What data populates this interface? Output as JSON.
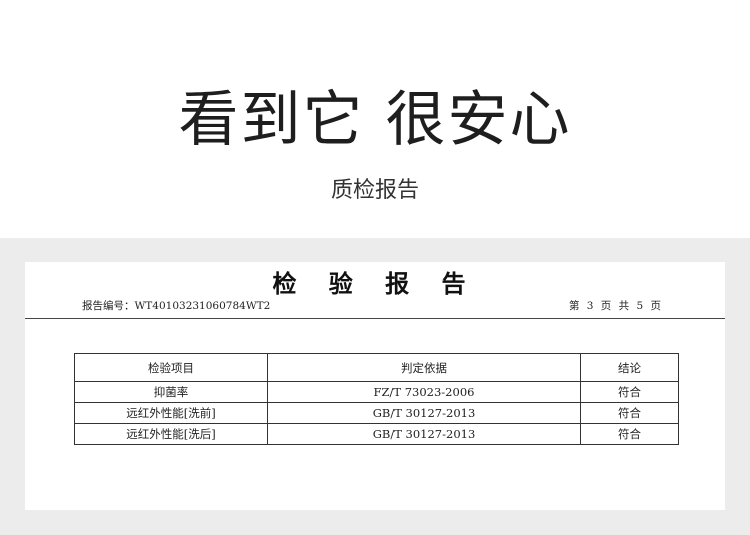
{
  "hero": {
    "title": "看到它 很安心",
    "subtitle": "质检报告"
  },
  "report": {
    "title": "检 验 报 告",
    "number_label": "报告编号：WT40103231060784WT2",
    "page_indicator": "第 3 页 共 5 页",
    "table": {
      "headers": [
        "检验项目",
        "判定依据",
        "结论"
      ],
      "rows": [
        [
          "抑菌率",
          "FZ/T 73023-2006",
          "符合"
        ],
        [
          "远红外性能[洗前]",
          "GB/T 30127-2013",
          "符合"
        ],
        [
          "远红外性能[洗后]",
          "GB/T 30127-2013",
          "符合"
        ]
      ]
    }
  }
}
